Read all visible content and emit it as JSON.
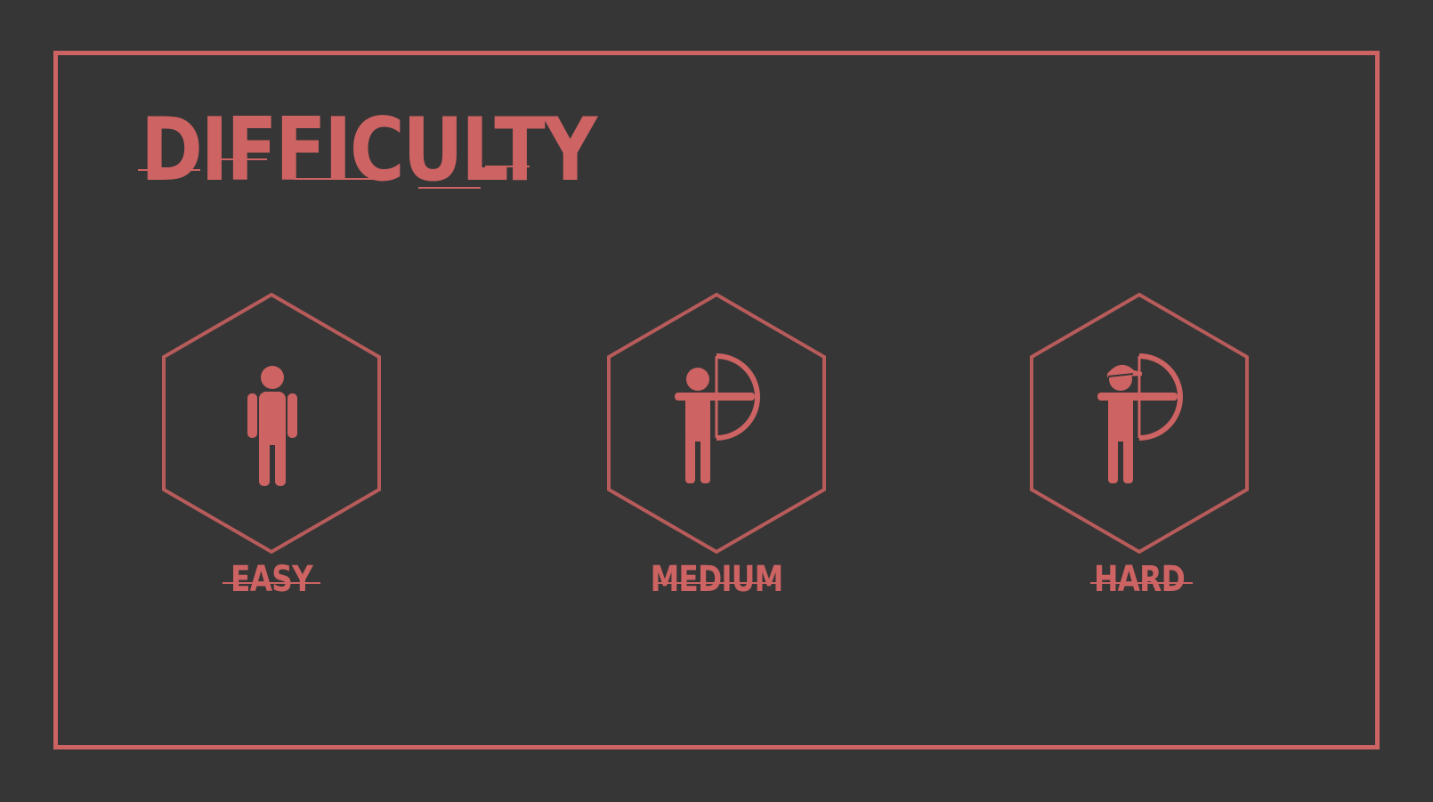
{
  "screen": {
    "title": "DIFFICULTY",
    "background_color": "#363636",
    "accent_color": "#cd6363"
  },
  "options": [
    {
      "label": "EASY",
      "icon": "standing-person-icon"
    },
    {
      "label": "MEDIUM",
      "icon": "archer-icon"
    },
    {
      "label": "HARD",
      "icon": "archer-with-cap-icon"
    }
  ]
}
